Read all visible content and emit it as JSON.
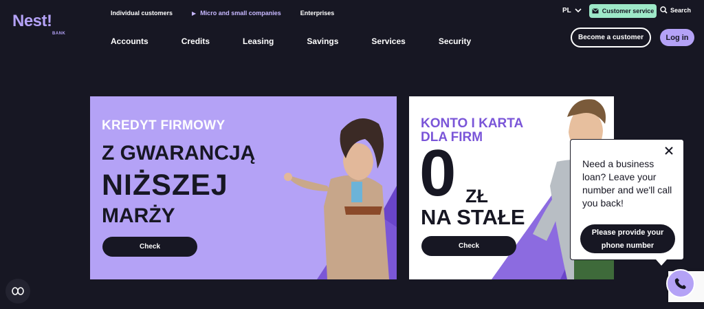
{
  "brand": {
    "name": "Nest!",
    "sub": "BANK"
  },
  "segments": [
    {
      "label": "Individual customers"
    },
    {
      "label": "Micro and small companies"
    },
    {
      "label": "Enterprises"
    }
  ],
  "nav": [
    {
      "label": "Accounts"
    },
    {
      "label": "Credits"
    },
    {
      "label": "Leasing"
    },
    {
      "label": "Savings"
    },
    {
      "label": "Services"
    },
    {
      "label": "Security"
    }
  ],
  "header": {
    "lang": "PL",
    "customer_service": "Customer service",
    "search": "Search",
    "become_customer": "Become a customer",
    "login": "Log in"
  },
  "banner1": {
    "kicker": "KREDYT FIRMOWY",
    "line2": "Z GWARANCJĄ",
    "line3": "NIŻSZEJ",
    "line4": "MARŻY",
    "cta": "Check"
  },
  "banner2": {
    "kicker": "KONTO I KARTA DLA FIRM",
    "zero": "0",
    "currency": "ZŁ",
    "tagline": "NA STAŁE",
    "cta": "Check"
  },
  "callback_popup": {
    "text": "Need a business loan? Leave your number and we'll call you back!",
    "button": "Please provide your phone number"
  },
  "colors": {
    "background": "#171723",
    "accent_purple": "#b4a2f6",
    "mint": "#9de8c8",
    "deep_purple": "#7a55d8"
  }
}
